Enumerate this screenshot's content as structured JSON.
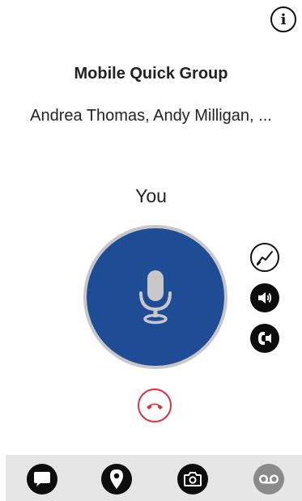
{
  "header": {
    "info_icon": "info-icon",
    "info_glyph": "i"
  },
  "call": {
    "group_name": "Mobile Quick Group",
    "participants": "Andrea Thomas, Andy Milligan, ...",
    "current_speaker": "You"
  },
  "controls": {
    "ptt_icon": "microphone-icon",
    "stats_icon": "line-chart-icon",
    "speaker_icon": "speaker-volume-icon",
    "handset_icon": "handset-icon",
    "end_call_icon": "phone-hangup-icon"
  },
  "bottom_bar": {
    "items": [
      {
        "icon": "chat-bubble-icon"
      },
      {
        "icon": "location-pin-icon"
      },
      {
        "icon": "camera-icon"
      },
      {
        "icon": "voicemail-icon"
      }
    ]
  },
  "colors": {
    "ptt_blue": "#1e4d96",
    "ptt_ring": "#c7c7c7",
    "end_call_red": "#e0323c",
    "bottom_bar_bg": "#e6e6e6"
  }
}
